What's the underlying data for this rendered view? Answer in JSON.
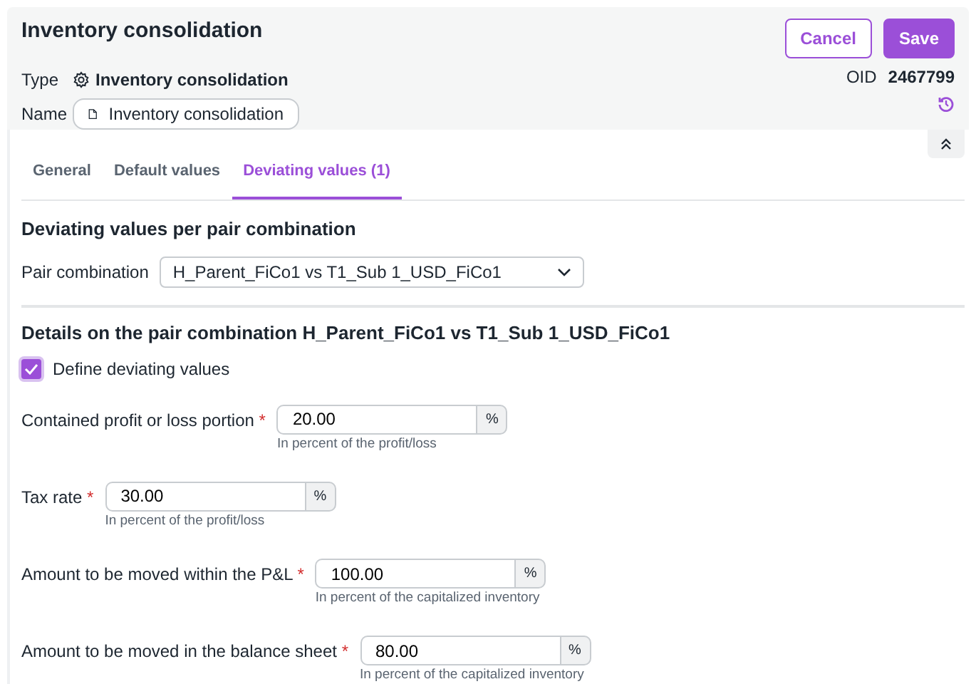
{
  "header": {
    "title": "Inventory consolidation",
    "type_label": "Type",
    "type_value": "Inventory consolidation",
    "name_label": "Name",
    "name_value": "Inventory consolidation",
    "cancel": "Cancel",
    "save": "Save",
    "oid_label": "OID",
    "oid_value": "2467799"
  },
  "tabs": [
    {
      "label": "General",
      "selected": false
    },
    {
      "label": "Default values",
      "selected": false
    },
    {
      "label": "Deviating values (1)",
      "selected": true
    }
  ],
  "section_title": "Deviating values per pair combination",
  "pair": {
    "label": "Pair combination",
    "value": "H_Parent_FiCo1 vs T1_Sub 1_USD_FiCo1"
  },
  "details_title": "Details on the pair combination H_Parent_FiCo1 vs T1_Sub 1_USD_FiCo1",
  "define": {
    "label": "Define deviating values",
    "checked": true
  },
  "fields": [
    {
      "label": "Contained profit or loss portion",
      "required_mark": "*",
      "value": "20.00",
      "unit": "%",
      "hint": "In percent of the profit/loss"
    },
    {
      "label": "Tax rate",
      "required_mark": "*",
      "value": "30.00",
      "unit": "%",
      "hint": "In percent of the profit/loss"
    },
    {
      "label": "Amount to be moved within the P&L",
      "required_mark": "*",
      "value": "100.00",
      "unit": "%",
      "hint": "In percent of the capitalized inventory"
    },
    {
      "label": "Amount to be moved in the balance sheet",
      "required_mark": "*",
      "value": "80.00",
      "unit": "%",
      "hint": "In percent of the capitalized inventory"
    }
  ]
}
